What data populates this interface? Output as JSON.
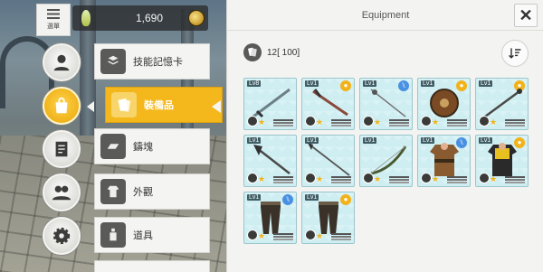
{
  "topbar": {
    "menu_label": "選單",
    "currency_value": "1,690"
  },
  "side_buttons": [
    {
      "name": "profile-icon",
      "active": false
    },
    {
      "name": "bag-icon",
      "active": true
    },
    {
      "name": "quest-icon",
      "active": false
    },
    {
      "name": "friends-icon",
      "active": false
    },
    {
      "name": "settings-icon",
      "active": false
    }
  ],
  "categories": [
    {
      "label": "技能記憶卡",
      "icon": "skill-card-icon",
      "active": false
    },
    {
      "label": "裝備品",
      "icon": "equipment-icon",
      "active": true
    },
    {
      "label": "鑄塊",
      "icon": "ingot-icon",
      "active": false
    },
    {
      "label": "外觀",
      "icon": "costume-icon",
      "active": false
    },
    {
      "label": "道具",
      "icon": "item-bottle-icon",
      "active": false
    }
  ],
  "panel": {
    "title": "Equipment",
    "close_label": "✕",
    "count_text": "12[ 100]"
  },
  "items": [
    {
      "level": "Lv8",
      "tag": "",
      "kind": "sword",
      "star": "★"
    },
    {
      "level": "Lv1",
      "tag": "gold",
      "kind": "sword-red",
      "star": "★"
    },
    {
      "level": "Lv1",
      "tag": "blue",
      "kind": "rapier",
      "star": "★"
    },
    {
      "level": "Lv1",
      "tag": "gold",
      "kind": "shield",
      "star": "★"
    },
    {
      "level": "Lv1",
      "tag": "gold",
      "kind": "mace",
      "star": "★"
    },
    {
      "level": "Lv1",
      "tag": "",
      "kind": "axe",
      "star": "★"
    },
    {
      "level": "Lv1",
      "tag": "",
      "kind": "spear",
      "star": "★"
    },
    {
      "level": "Lv1",
      "tag": "",
      "kind": "bow",
      "star": "★"
    },
    {
      "level": "Lv1",
      "tag": "blue",
      "kind": "armor-brown",
      "star": "★"
    },
    {
      "level": "Lv1",
      "tag": "gold",
      "kind": "armor-yellow",
      "star": "★"
    },
    {
      "level": "Lv1",
      "tag": "blue",
      "kind": "pants",
      "star": "★"
    },
    {
      "level": "Lv1",
      "tag": "gold",
      "kind": "pants",
      "star": "★"
    }
  ],
  "colors": {
    "accent": "#f4b81c",
    "card_bg": "#cfeef2",
    "tag_gold": "#f2b21a",
    "tag_blue": "#4a90e2"
  }
}
